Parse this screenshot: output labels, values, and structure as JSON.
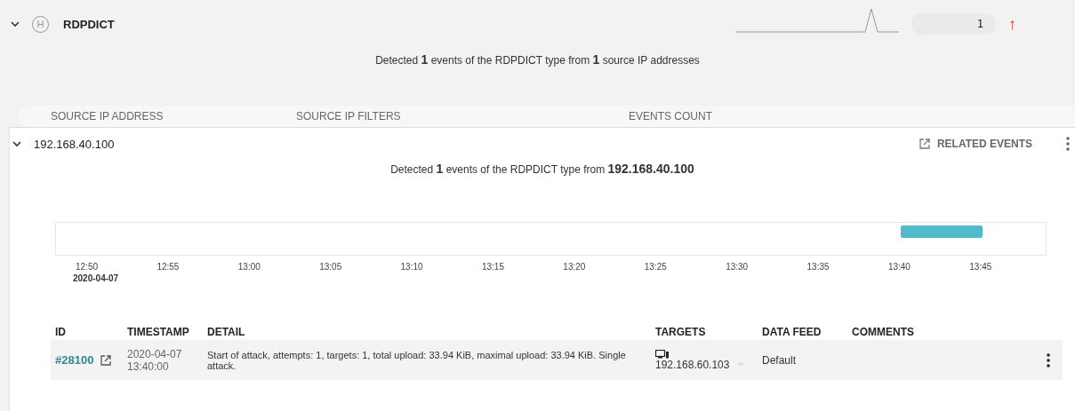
{
  "group": {
    "expanded": true,
    "badge": "H",
    "name": "RDPDICT",
    "count": "1",
    "trend_icon": "↑",
    "summary": "Detected **1** events of the RDPDICT type from **1** source IP addresses"
  },
  "columns": [
    "SOURCE IP ADDRESS",
    "SOURCE IP FILTERS",
    "EVENTS COUNT"
  ],
  "source": {
    "expanded": true,
    "ip": "192.168.40.100",
    "related_events": "RELATED EVENTS",
    "summary": "Detected **1** events of the RDPDICT type from **192.168.40.100**"
  },
  "timeline": {
    "ticks": [
      "12:50",
      "12:55",
      "13:00",
      "13:05",
      "13:10",
      "13:15",
      "13:20",
      "13:25",
      "13:30",
      "13:35",
      "13:40",
      "13:45"
    ],
    "date": "2020-04-07"
  },
  "events": {
    "columns": [
      "ID",
      "TIMESTAMP",
      "DETAIL",
      "TARGETS",
      "DATA FEED",
      "COMMENTS"
    ],
    "rows": [
      {
        "id": "#28100",
        "date": "2020-04-07",
        "time": "13:40:00",
        "detail": "Start of attack, attempts: 1, targets: 1, total upload: 33.94 KiB, maximal upload: 33.94 KiB. Single attack.",
        "target": "192.168.60.103",
        "data_feed": "Default"
      }
    ]
  }
}
